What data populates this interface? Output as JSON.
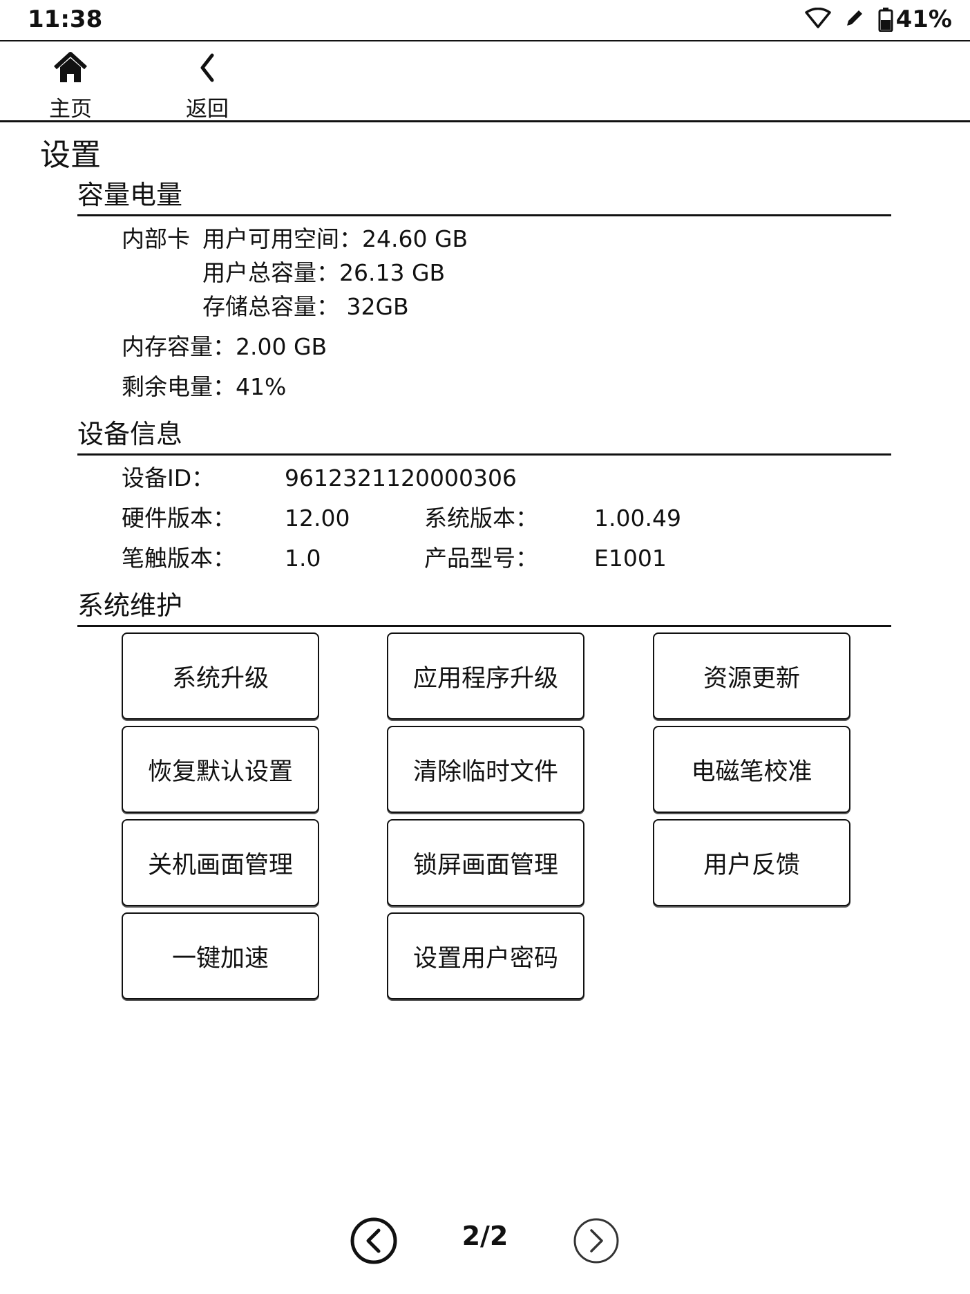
{
  "status_bar": {
    "time": "11:38",
    "battery_percent": "41%",
    "icons": [
      "wifi-icon",
      "pen-icon",
      "battery-icon"
    ]
  },
  "nav": {
    "home_label": "主页",
    "back_label": "返回"
  },
  "page_title": "设置",
  "storage": {
    "header": "容量电量",
    "internal_prefix": "内部卡",
    "user_available": "用户可用空间：24.60 GB",
    "user_total": "用户总容量：26.13 GB",
    "storage_total": "存储总容量： 32GB",
    "memory": "内存容量：2.00 GB",
    "battery_remaining": "剩余电量：41%"
  },
  "device_info": {
    "header": "设备信息",
    "device_id_label": "设备ID：",
    "device_id_value": "9612321120000306",
    "hw_label": "硬件版本：",
    "hw_value": "12.00",
    "sys_label": "系统版本：",
    "sys_value": "1.00.49",
    "pen_label": "笔触版本：",
    "pen_value": "1.0",
    "model_label": "产品型号：",
    "model_value": "E1001"
  },
  "maintenance": {
    "header": "系统维护",
    "buttons": [
      "系统升级",
      "应用程序升级",
      "资源更新",
      "恢复默认设置",
      "清除临时文件",
      "电磁笔校准",
      "关机画面管理",
      "锁屏画面管理",
      "用户反馈",
      "一键加速",
      "设置用户密码"
    ]
  },
  "pager": {
    "indicator": "2/2"
  }
}
